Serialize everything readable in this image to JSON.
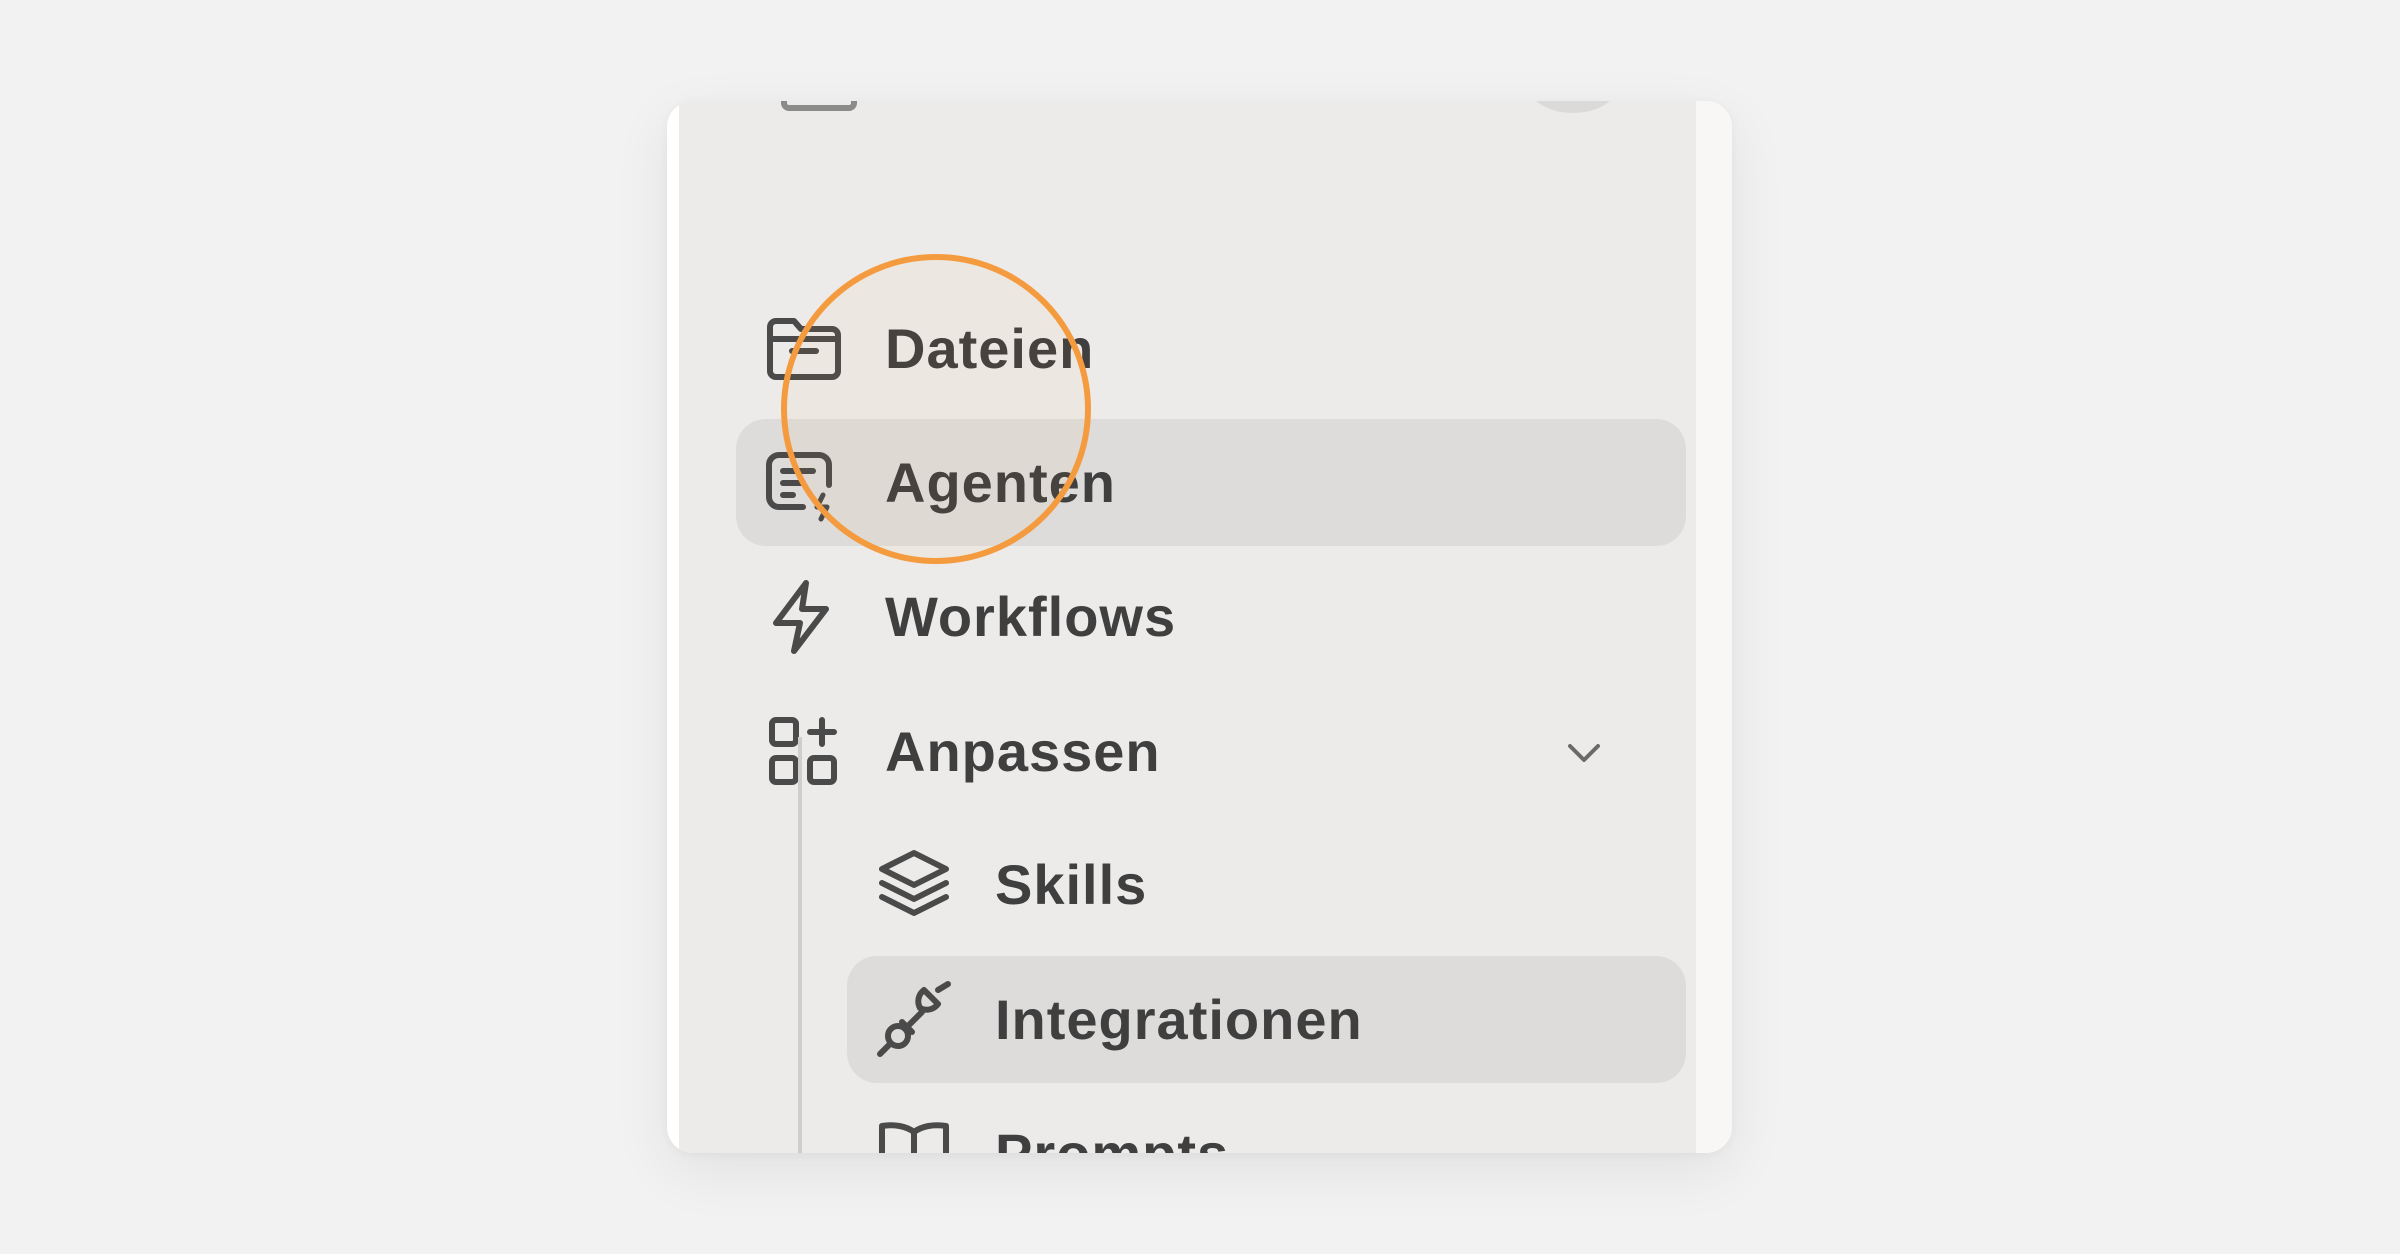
{
  "sidebar": {
    "items": [
      {
        "label": "Dateien",
        "icon": "folder-icon",
        "active": false
      },
      {
        "label": "Agenten",
        "icon": "agent-icon",
        "active": true
      },
      {
        "label": "Workflows",
        "icon": "lightning-icon",
        "active": false
      },
      {
        "label": "Anpassen",
        "icon": "customize-grid-icon",
        "active": false,
        "expanded": true
      }
    ],
    "subitems": [
      {
        "label": "Skills",
        "icon": "layers-icon",
        "active": false
      },
      {
        "label": "Integrationen",
        "icon": "plug-icon",
        "active": true
      },
      {
        "label": "Prompts",
        "icon": "book-icon",
        "active": false
      }
    ]
  },
  "colors": {
    "page_background": "#f2f2f2",
    "sidebar_background": "#ecebe9",
    "active_item_background": "#dddcda",
    "text": "#3f3f3f",
    "highlight_ring": "#f59b3f"
  }
}
